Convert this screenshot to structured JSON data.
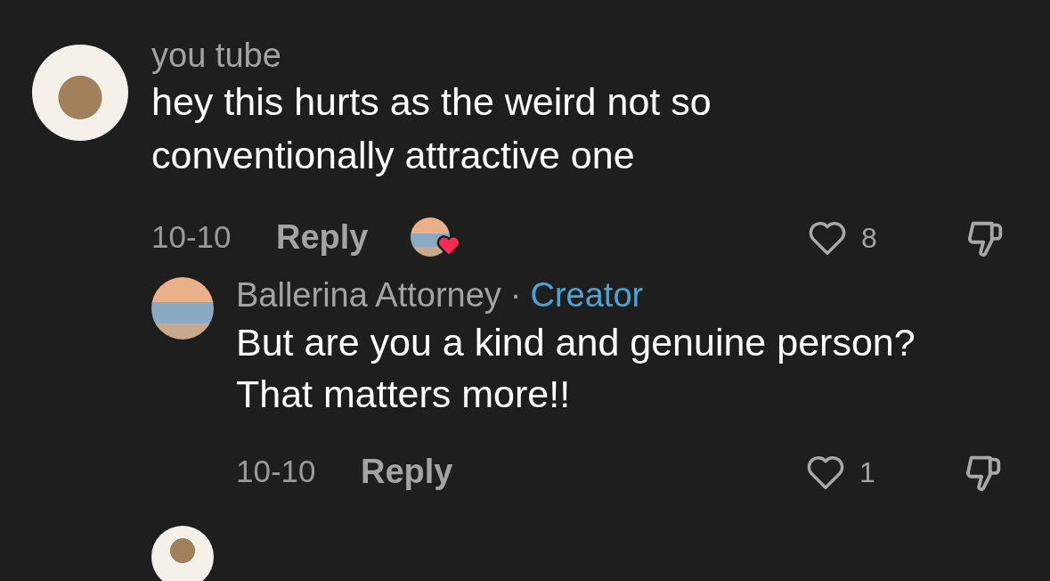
{
  "comments": [
    {
      "username": "you tube",
      "text": "hey this hurts as the weird not so conventionally attractive one",
      "date": "10-10",
      "reply_label": "Reply",
      "liked_by_creator": true,
      "likes": "8",
      "liked": false,
      "children": [
        {
          "username": "Ballerina Attorney",
          "separator": "·",
          "badge": "Creator",
          "text": "But are you a kind and genuine person? That matters more!!",
          "date": "10-10",
          "reply_label": "Reply",
          "liked_by_creator": false,
          "likes": "1",
          "liked": false
        }
      ]
    }
  ]
}
